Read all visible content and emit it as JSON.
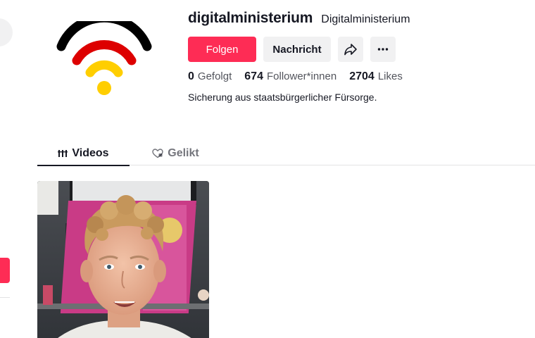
{
  "profile": {
    "username": "digitalministerium",
    "nickname": "Digitalministerium",
    "bio": "Sicherung aus staatsbürgerlicher Fürsorge."
  },
  "buttons": {
    "follow": "Folgen",
    "message": "Nachricht",
    "share_icon": "share-arrow-icon",
    "more_icon": "more-dots-icon"
  },
  "stats": [
    {
      "value": "0",
      "label": "Gefolgt"
    },
    {
      "value": "674",
      "label": "Follower*innen"
    },
    {
      "value": "2704",
      "label": "Likes"
    }
  ],
  "tabs": [
    {
      "label": "Videos",
      "icon": "grid-lines-icon",
      "active": true
    },
    {
      "label": "Gelikt",
      "icon": "heart-lock-icon",
      "active": false
    }
  ],
  "avatar": {
    "icon": "wifi-flag-icon",
    "colors": [
      "#000000",
      "#dd0000",
      "#ffce00"
    ]
  },
  "colors": {
    "accent": "#fe2c55",
    "text": "#161823",
    "button_bg": "#f1f1f2"
  }
}
